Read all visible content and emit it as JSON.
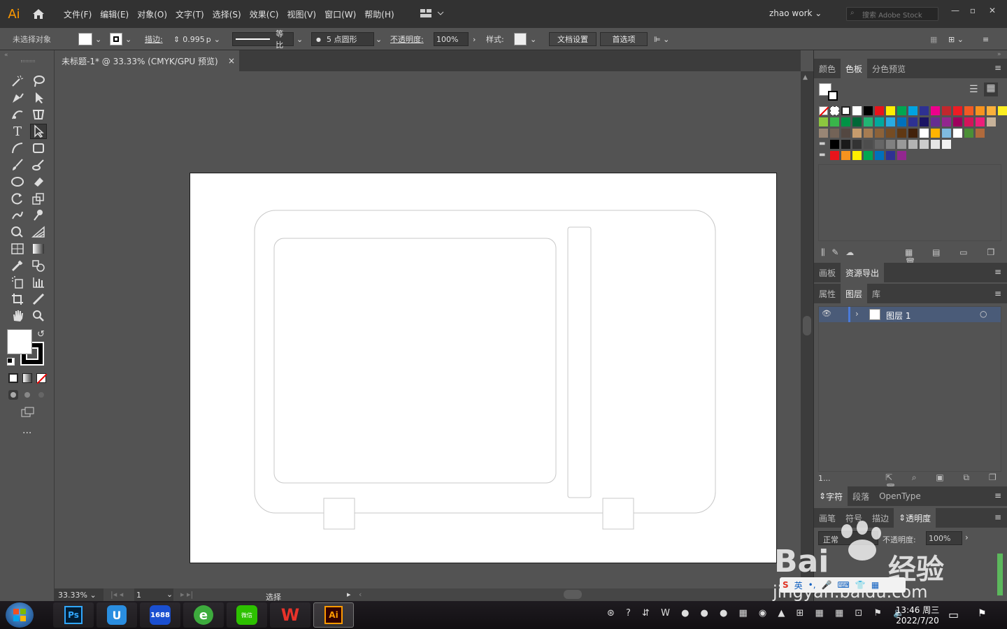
{
  "app": {
    "logo": "Ai",
    "workspace": "zhao work",
    "search_placeholder": "搜索 Adobe Stock"
  },
  "menu": [
    "文件(F)",
    "编辑(E)",
    "对象(O)",
    "文字(T)",
    "选择(S)",
    "效果(C)",
    "视图(V)",
    "窗口(W)",
    "帮助(H)"
  ],
  "control": {
    "no_selection": "未选择对象",
    "stroke_label": "描边:",
    "stroke_value": "0.995",
    "stroke_unit": "p",
    "profile": "等比",
    "brush": "5 点圆形",
    "opacity_label": "不透明度:",
    "opacity_value": "100%",
    "style_label": "样式:",
    "doc_setup": "文档设置",
    "prefs": "首选项"
  },
  "document": {
    "tab_title": "未标题-1* @ 33.33% (CMYK/GPU 预览)",
    "close": "×"
  },
  "status": {
    "zoom": "33.33%",
    "page": "1",
    "tool": "选择"
  },
  "panels": {
    "color_tabs": [
      "颜色",
      "色板",
      "分色预览"
    ],
    "active_color_tab": "色板",
    "asset_tabs": [
      "画板",
      "资源导出"
    ],
    "layer_tabs": [
      "属性",
      "图层",
      "库"
    ],
    "layer_name": "图层 1",
    "layer_count": "1...",
    "char_tabs": [
      "字符",
      "段落",
      "OpenType"
    ],
    "trans_tabs": [
      "画笔",
      "符号",
      "描边",
      "透明度"
    ],
    "blend_mode": "正常",
    "trans_opacity_label": "不透明度:",
    "trans_opacity_value": "100%"
  },
  "swatches": {
    "row1": [
      "#ffffff",
      "#000000",
      "#e8141b",
      "#ffee00",
      "#00a651",
      "#00a3e0",
      "#2e3192",
      "#ec008c",
      "#c1272d",
      "#ed1c24",
      "#f15a24",
      "#f7931e",
      "#fbb03b",
      "#fcee21",
      "#d9e021"
    ],
    "row2": [
      "#8cc63f",
      "#39b54a",
      "#009245",
      "#006837",
      "#22b573",
      "#00a99d",
      "#29abe2",
      "#0071bc",
      "#2e3192",
      "#1b1464",
      "#662d91",
      "#93278f",
      "#9e005d",
      "#d4145a",
      "#ed1e79",
      "#c7b299"
    ],
    "row3": [
      "#998675",
      "#736357",
      "#534741",
      "#c69c6d",
      "#a67c52",
      "#8c6239",
      "#754c24",
      "#603813",
      "#42210b",
      "#ffffff",
      "#ffb400",
      "#7fbbe0",
      "#ffffff",
      "#4b8f36",
      "#b06a3c"
    ],
    "row4": [
      "#000000",
      "#1a1a1a",
      "#333333",
      "#4d4d4d",
      "#666666",
      "#808080",
      "#999999",
      "#b3b3b3",
      "#cccccc",
      "#e6e6e6",
      "#f2f2f2"
    ],
    "row5": [
      "#e8141b",
      "#f7931e",
      "#ffee00",
      "#00a651",
      "#0071bc",
      "#2e3192",
      "#93278f"
    ]
  },
  "taskbar": {
    "time": "13:46 周三",
    "date": "2022/7/20",
    "ime": "英",
    "icons": [
      "Ps",
      "U",
      "1688",
      "e",
      "微信",
      "W",
      "Ai"
    ]
  },
  "watermark": {
    "brand": "Bai",
    "brand2": "经验",
    "url": "jingyan.baidu.com"
  }
}
